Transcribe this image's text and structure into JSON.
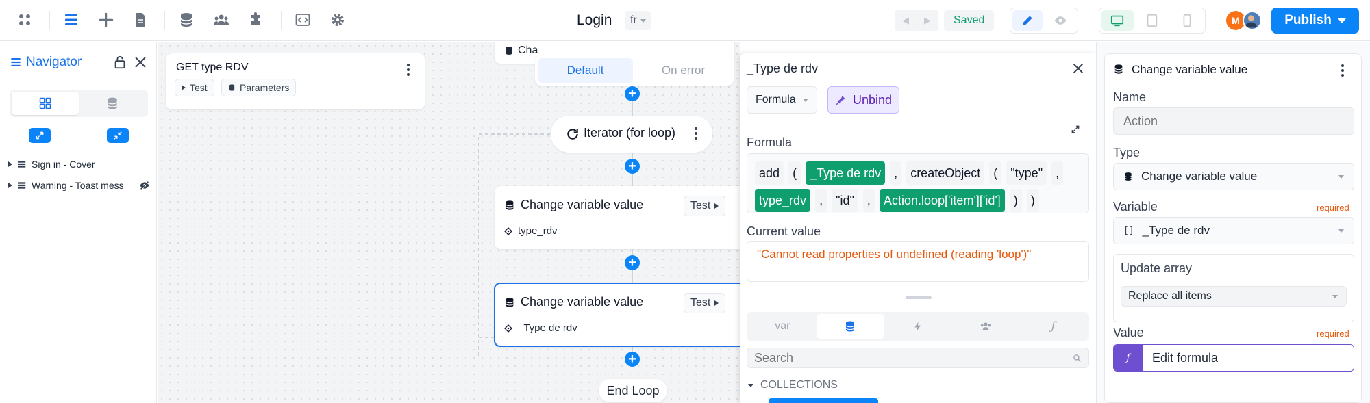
{
  "topbar": {
    "page_title": "Login",
    "lang": "fr",
    "saved": "Saved",
    "publish": "Publish",
    "avatar_initial": "M",
    "icons": [
      "grid-icon",
      "layers-icon",
      "plus-icon",
      "page-icon",
      "database-icon",
      "users-icon",
      "plugin-icon",
      "code-icon",
      "settings-icon"
    ]
  },
  "navigator": {
    "title": "Navigator",
    "items": [
      {
        "label": "Sign in - Cover"
      },
      {
        "label": "Warning - Toast mess"
      }
    ]
  },
  "canvas": {
    "get_card": {
      "title": "GET type RDV",
      "test": "Test",
      "params": "Parameters"
    },
    "top_card_partial": "Cha",
    "branch_tabs": {
      "default": "Default",
      "on_error": "On error"
    },
    "iterator": {
      "title": "Iterator (for loop)"
    },
    "change1": {
      "title": "Change variable value",
      "test": "Test",
      "variable": "type_rdv"
    },
    "change2": {
      "title": "Change variable value",
      "test": "Test",
      "variable": "_Type de rdv"
    },
    "end_loop": "End Loop"
  },
  "formula_panel": {
    "title": "_Type de rdv",
    "mode": "Formula",
    "unbind": "Unbind",
    "formula_label": "Formula",
    "tokens_line1": [
      {
        "t": "add",
        "k": "g"
      },
      {
        "t": "(",
        "k": "g"
      },
      {
        "t": "_Type de rdv",
        "k": "v"
      },
      {
        "t": ",",
        "k": "g"
      },
      {
        "t": "createObject",
        "k": "g"
      },
      {
        "t": "(",
        "k": "g"
      },
      {
        "t": "\"type\"",
        "k": "g"
      },
      {
        "t": ",",
        "k": "g"
      }
    ],
    "tokens_line2": [
      {
        "t": "type_rdv",
        "k": "v"
      },
      {
        "t": ",",
        "k": "g"
      },
      {
        "t": "\"id\"",
        "k": "g"
      },
      {
        "t": ",",
        "k": "g"
      },
      {
        "t": "Action.loop['item']['id']",
        "k": "v"
      },
      {
        "t": ")",
        "k": "g"
      },
      {
        "t": ")",
        "k": "g"
      }
    ],
    "current_label": "Current value",
    "current_value": "\"Cannot read properties of undefined (reading 'loop')\"",
    "tabs": [
      "var"
    ],
    "search_placeholder": "Search",
    "collections": "COLLECTIONS"
  },
  "right_panel": {
    "title": "Change variable value",
    "name_label": "Name",
    "name_placeholder": "Action",
    "type_label": "Type",
    "type_value": "Change variable value",
    "variable_label": "Variable",
    "required": "required",
    "variable_prefix": "[]",
    "variable_value": "_Type de rdv",
    "update_label": "Update array",
    "update_value": "Replace all items",
    "value_label": "Value",
    "value_required": "required",
    "value_formula": "Edit formula"
  },
  "colors": {
    "primary": "#0a84f6",
    "green": "#0f9f6e",
    "error": "#ea580c",
    "unbind_bg": "#ede9fe",
    "formula_purple": "#6d4fcf"
  }
}
